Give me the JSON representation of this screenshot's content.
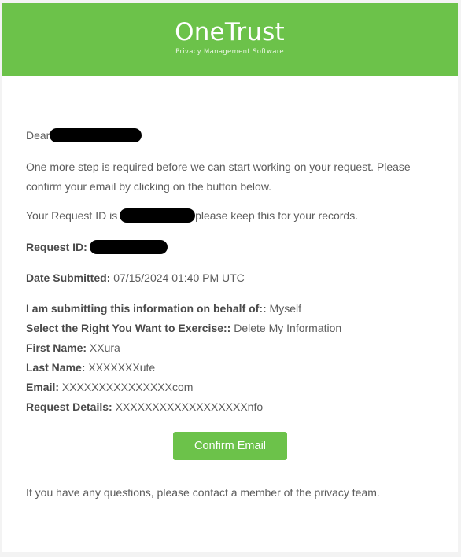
{
  "header": {
    "brand": "OneTrust",
    "tagline": "Privacy Management Software",
    "background_color": "#6cc24a"
  },
  "greeting": {
    "salutation": "Dear"
  },
  "intro": {
    "text": "One more step is required before we can start working on your request. Please confirm your email by clicking on the button below."
  },
  "request_id_line": {
    "prefix": "Your Request ID is",
    "suffix": "please keep this for your records."
  },
  "request_id": {
    "label": "Request ID:"
  },
  "date_submitted": {
    "label": "Date Submitted:",
    "value": "07/15/2024 01:40 PM UTC"
  },
  "details": [
    {
      "label": "I am submitting this information on behalf of::",
      "value": "Myself"
    },
    {
      "label": "Select the Right You Want to Exercise::",
      "value": "Delete My Information"
    },
    {
      "label": "First Name:",
      "value": "XXura"
    },
    {
      "label": "Last Name:",
      "value": "XXXXXXXute"
    },
    {
      "label": "Email:",
      "value": "XXXXXXXXXXXXXXXcom"
    },
    {
      "label": "Request Details:",
      "value": "XXXXXXXXXXXXXXXXXXnfo"
    }
  ],
  "confirm_button": {
    "label": "Confirm Email",
    "color": "#6cc24a"
  },
  "footer": {
    "text": "If you have any questions, please contact a member of the privacy team."
  }
}
